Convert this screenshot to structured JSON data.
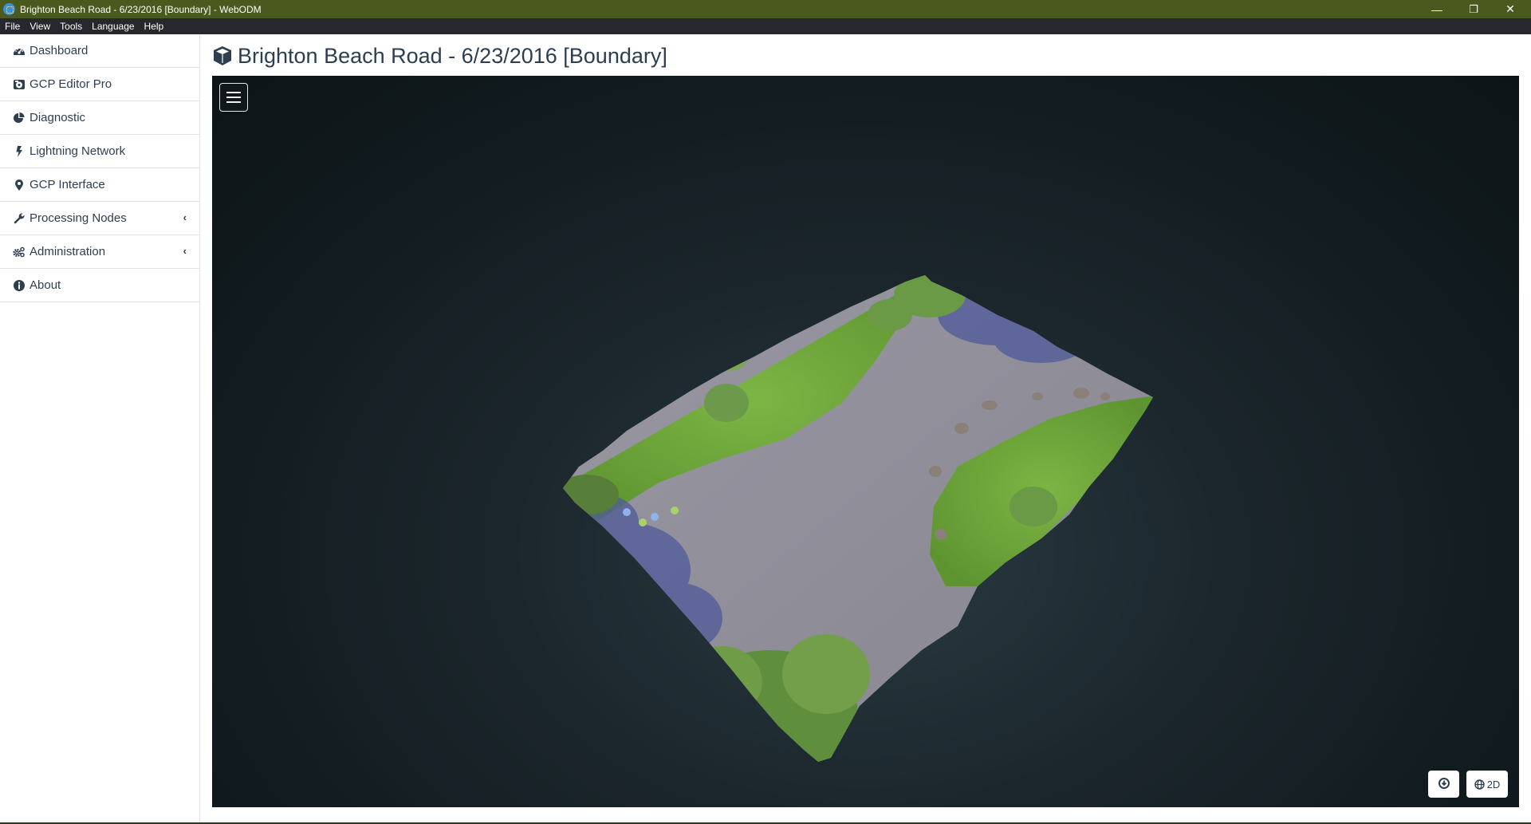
{
  "window": {
    "title": "Brighton Beach Road - 6/23/2016 [Boundary] - WebODM",
    "icon": "webodm-logo-icon",
    "controls": {
      "minimize": "—",
      "restore": "❐",
      "close": "✕"
    }
  },
  "menubar": {
    "items": [
      "File",
      "View",
      "Tools",
      "Language",
      "Help"
    ]
  },
  "sidebar": {
    "items": [
      {
        "label": "Dashboard",
        "icon": "tachometer-icon",
        "has_submenu": false
      },
      {
        "label": "GCP Editor Pro",
        "icon": "gcp-editor-icon",
        "has_submenu": false
      },
      {
        "label": "Diagnostic",
        "icon": "pie-chart-icon",
        "has_submenu": false
      },
      {
        "label": "Lightning Network",
        "icon": "bolt-icon",
        "has_submenu": false
      },
      {
        "label": "GCP Interface",
        "icon": "map-marker-icon",
        "has_submenu": false
      },
      {
        "label": "Processing Nodes",
        "icon": "wrench-icon",
        "has_submenu": true
      },
      {
        "label": "Administration",
        "icon": "cogs-icon",
        "has_submenu": true
      },
      {
        "label": "About",
        "icon": "info-circle-icon",
        "has_submenu": false
      }
    ],
    "submenu_chevron": "‹"
  },
  "page": {
    "title": "Brighton Beach Road - 6/23/2016 [Boundary]",
    "title_icon": "cube-icon"
  },
  "viewer": {
    "menu_button": "hamburger-menu-icon",
    "download_button_icon": "download-icon",
    "view_2d_label": "2D",
    "view_2d_icon": "globe-icon"
  },
  "colors": {
    "titlebar": "#4a5a1e",
    "menubar": "#26282d",
    "text": "#2c3e50",
    "viewer_bg": "#111a1e",
    "grass": "#6fa33a",
    "road": "#8f8e98",
    "shadow": "#4f5a9a"
  }
}
